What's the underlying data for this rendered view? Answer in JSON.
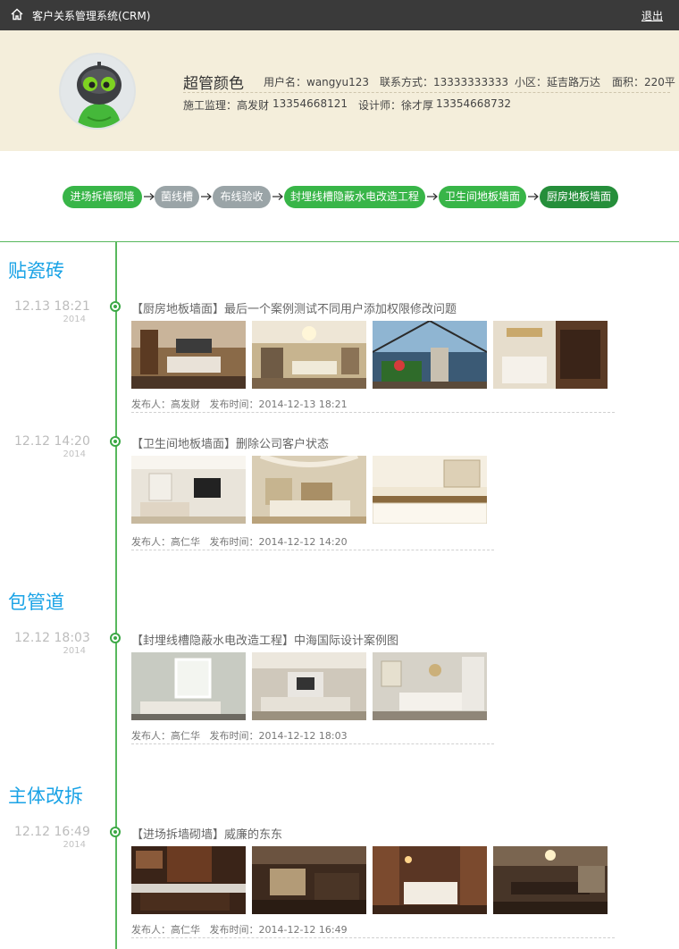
{
  "app": {
    "title": "客户关系管理系统(CRM)",
    "logout": "退出"
  },
  "profile": {
    "name": "超管颜色",
    "username": "用户名：wangyu123",
    "contact": "联系方式：13333333333",
    "community": "小区：延吉路万达",
    "area": "面积：220平",
    "supervisor": "施工监理：高发财",
    "supervisor_phone": "13354668121",
    "designer": "设计师：徐才厚",
    "designer_phone": "13354668732"
  },
  "steps": [
    {
      "label": "进场拆墙砌墙",
      "state": "done"
    },
    {
      "label": "菌线槽",
      "state": "todo"
    },
    {
      "label": "布线验收",
      "state": "todo"
    },
    {
      "label": "封埋线槽隐蔽水电改造工程",
      "state": "done"
    },
    {
      "label": "卫生间地板墙面",
      "state": "done"
    },
    {
      "label": "厨房地板墙面",
      "state": "current"
    }
  ],
  "timeline": [
    {
      "section": "贴瓷砖",
      "entries": [
        {
          "time": "12.13 18:21",
          "year": "2014",
          "title": "【厨房地板墙面】最后一个案例测试不同用户添加权限修改问题",
          "publisher": "发布人：高发财",
          "published": "发布时间：2014-12-13 18:21",
          "photos": [
            "living-room-photo",
            "living-room-photo",
            "terrace-photo",
            "kitchen-photo"
          ]
        },
        {
          "time": "12.12 14:20",
          "year": "2014",
          "title": "【卫生间地板墙面】删除公司客户状态",
          "publisher": "发布人：高仁华",
          "published": "发布时间：2014-12-12 14:20",
          "photos": [
            "living-room-photo",
            "living-room-photo",
            "kitchen-photo"
          ]
        }
      ]
    },
    {
      "section": "包管道",
      "entries": [
        {
          "time": "12.12 18:03",
          "year": "2014",
          "title": "【封埋线槽隐蔽水电改造工程】中海国际设计案例图",
          "publisher": "发布人：高仁华",
          "published": "发布时间：2014-12-12 18:03",
          "photos": [
            "living-room-photo",
            "living-room-photo",
            "dining-room-photo"
          ]
        }
      ]
    },
    {
      "section": "主体改拆",
      "entries": [
        {
          "time": "12.12 16:49",
          "year": "2014",
          "title": "【进场拆墙砌墙】威廉的东东",
          "publisher": "发布人：高仁华",
          "published": "发布时间：2014-12-12 16:49",
          "photos": [
            "kitchen-photo",
            "living-room-photo",
            "bedroom-photo",
            "dining-room-photo"
          ]
        }
      ]
    }
  ],
  "colors": {
    "accent_green": "#38b548",
    "current_step": "#258e3a",
    "pending_step": "#9aa4a7",
    "section_blue": "#1aa3e6",
    "profile_bg": "#f4eedb",
    "topbar_bg": "#3a3a3a"
  }
}
